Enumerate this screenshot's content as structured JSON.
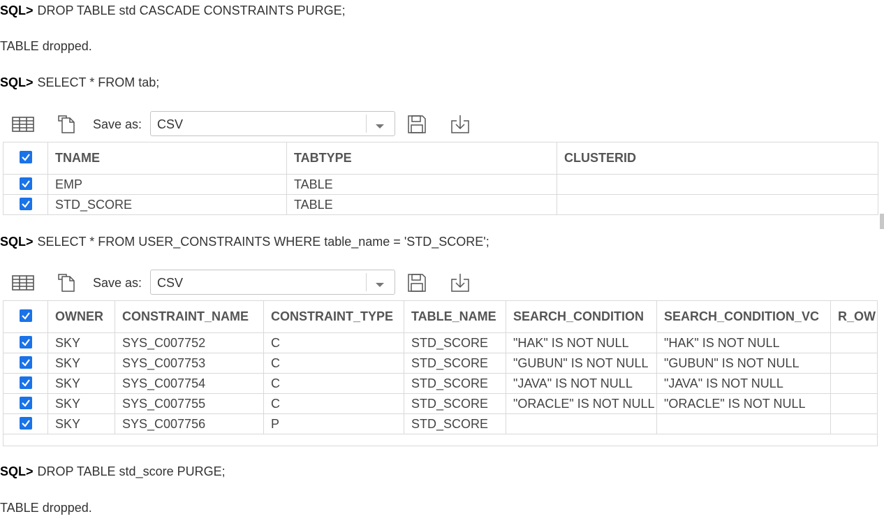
{
  "console": {
    "lines": [
      {
        "prompt": "SQL>",
        "text": "DROP TABLE std CASCADE CONSTRAINTS PURGE;"
      },
      {
        "text": "TABLE dropped."
      },
      {
        "prompt": "SQL>",
        "text": "SELECT * FROM tab;"
      },
      {
        "prompt": "SQL>",
        "text": "SELECT * FROM USER_CONSTRAINTS WHERE table_name = 'STD_SCORE';"
      },
      {
        "prompt": "SQL>",
        "text": "DROP TABLE std_score PURGE;"
      },
      {
        "text": "TABLE dropped."
      }
    ]
  },
  "toolbar1": {
    "save_as_label": "Save as:",
    "format": "CSV"
  },
  "toolbar2": {
    "save_as_label": "Save as:",
    "format": "CSV"
  },
  "result1": {
    "columns": [
      "TNAME",
      "TABTYPE",
      "CLUSTERID"
    ],
    "rows": [
      [
        "EMP",
        "TABLE",
        ""
      ],
      [
        "STD_SCORE",
        "TABLE",
        ""
      ]
    ]
  },
  "result2": {
    "columns": [
      "OWNER",
      "CONSTRAINT_NAME",
      "CONSTRAINT_TYPE",
      "TABLE_NAME",
      "SEARCH_CONDITION",
      "SEARCH_CONDITION_VC",
      "R_OW"
    ],
    "rows": [
      [
        "SKY",
        "SYS_C007752",
        "C",
        "STD_SCORE",
        "\"HAK\" IS NOT NULL",
        "\"HAK\" IS NOT NULL",
        ""
      ],
      [
        "SKY",
        "SYS_C007753",
        "C",
        "STD_SCORE",
        "\"GUBUN\" IS NOT NULL",
        "\"GUBUN\" IS NOT NULL",
        ""
      ],
      [
        "SKY",
        "SYS_C007754",
        "C",
        "STD_SCORE",
        "\"JAVA\" IS NOT NULL",
        "\"JAVA\" IS NOT NULL",
        ""
      ],
      [
        "SKY",
        "SYS_C007755",
        "C",
        "STD_SCORE",
        "\"ORACLE\" IS NOT NULL",
        "\"ORACLE\" IS NOT NULL",
        ""
      ],
      [
        "SKY",
        "SYS_C007756",
        "P",
        "STD_SCORE",
        "",
        "",
        ""
      ]
    ]
  },
  "colors": {
    "checkbox": "#1a73e8",
    "border": "#d9d9d9",
    "text": "#333333"
  }
}
